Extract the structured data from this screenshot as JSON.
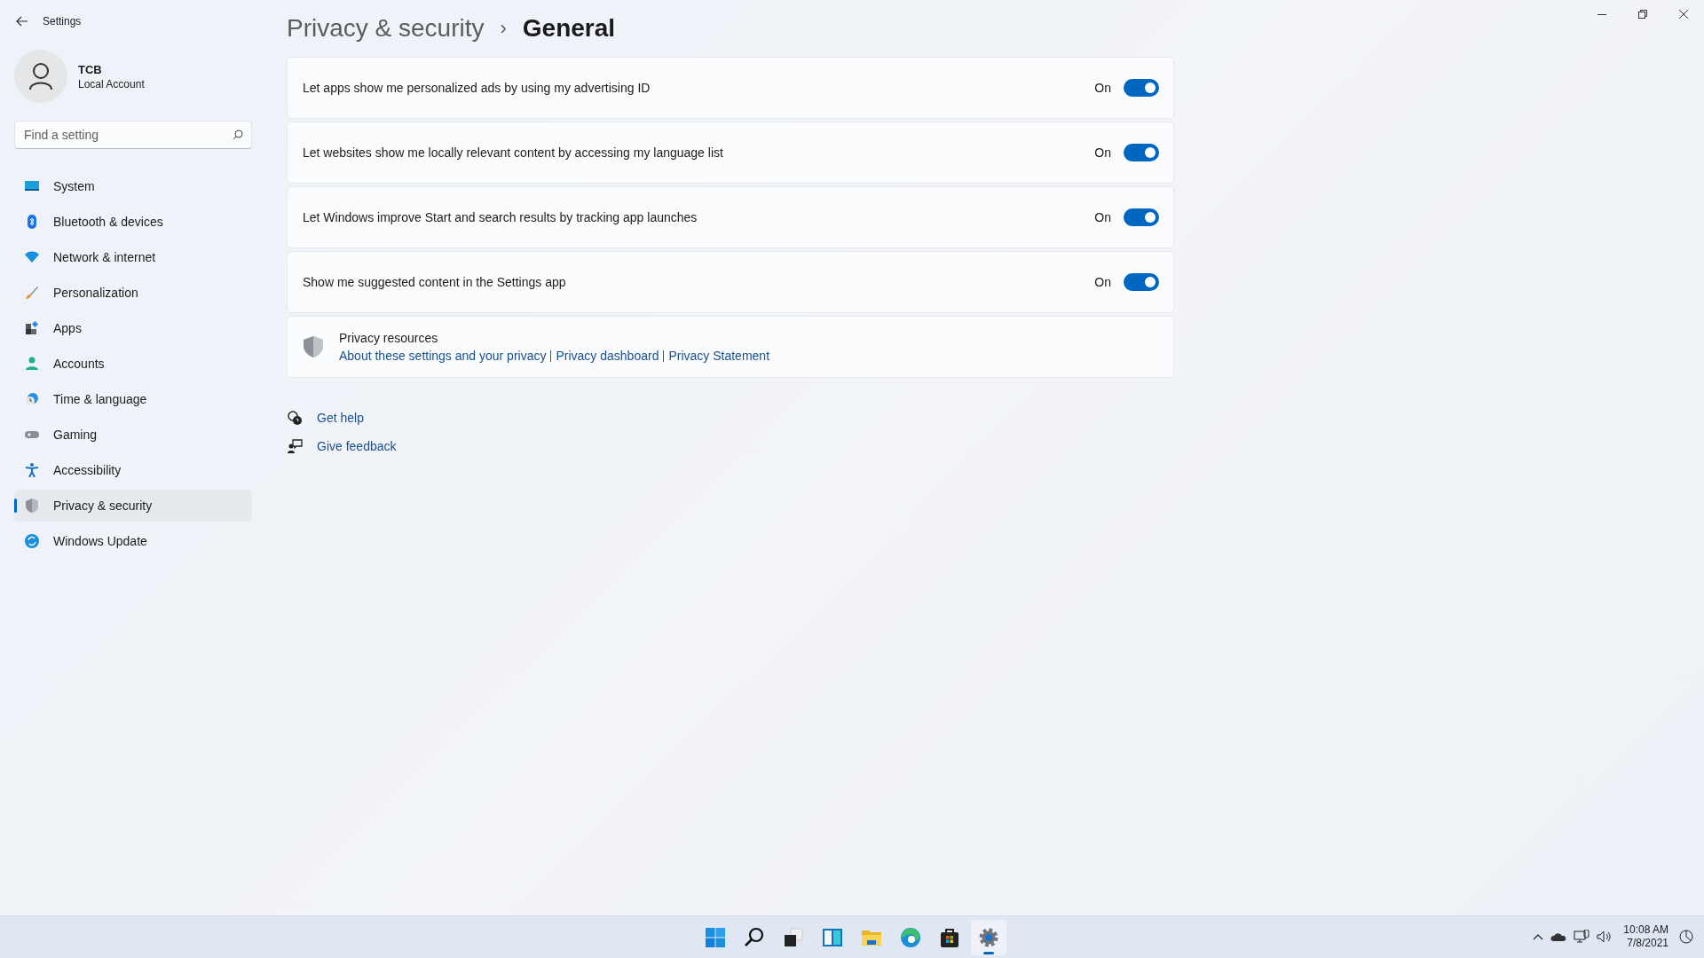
{
  "window": {
    "title": "Settings"
  },
  "account": {
    "name": "TCB",
    "type": "Local Account"
  },
  "search": {
    "placeholder": "Find a setting"
  },
  "nav": [
    {
      "label": "System",
      "kind": "system",
      "selected": false
    },
    {
      "label": "Bluetooth & devices",
      "kind": "bluetooth",
      "selected": false
    },
    {
      "label": "Network & internet",
      "kind": "network",
      "selected": false
    },
    {
      "label": "Personalization",
      "kind": "brush",
      "selected": false
    },
    {
      "label": "Apps",
      "kind": "apps",
      "selected": false
    },
    {
      "label": "Accounts",
      "kind": "accounts",
      "selected": false
    },
    {
      "label": "Time & language",
      "kind": "time",
      "selected": false
    },
    {
      "label": "Gaming",
      "kind": "gaming",
      "selected": false
    },
    {
      "label": "Accessibility",
      "kind": "accessibility",
      "selected": false
    },
    {
      "label": "Privacy & security",
      "kind": "privacy",
      "selected": true
    },
    {
      "label": "Windows Update",
      "kind": "update",
      "selected": false
    }
  ],
  "breadcrumb": {
    "parent": "Privacy & security",
    "separator": "›",
    "current": "General"
  },
  "settings": [
    {
      "label": "Let apps show me personalized ads by using my advertising ID",
      "state_label": "On",
      "on": true
    },
    {
      "label": "Let websites show me locally relevant content by accessing my language list",
      "state_label": "On",
      "on": true
    },
    {
      "label": "Let Windows improve Start and search results by tracking app launches",
      "state_label": "On",
      "on": true
    },
    {
      "label": "Show me suggested content in the Settings app",
      "state_label": "On",
      "on": true
    }
  ],
  "resources": {
    "title": "Privacy resources",
    "links": [
      "About these settings and your privacy",
      "Privacy dashboard",
      "Privacy Statement"
    ]
  },
  "help_links": [
    {
      "label": "Get help",
      "kind": "help"
    },
    {
      "label": "Give feedback",
      "kind": "feedback"
    }
  ],
  "taskbar": {
    "apps": [
      {
        "kind": "start",
        "selected": false
      },
      {
        "kind": "search",
        "selected": false
      },
      {
        "kind": "taskview",
        "selected": false
      },
      {
        "kind": "widgets",
        "selected": false
      },
      {
        "kind": "explorer",
        "selected": false
      },
      {
        "kind": "edge",
        "selected": false
      },
      {
        "kind": "store",
        "selected": false
      },
      {
        "kind": "settings",
        "selected": true
      }
    ],
    "time": "10:08 AM",
    "date": "7/8/2021"
  }
}
